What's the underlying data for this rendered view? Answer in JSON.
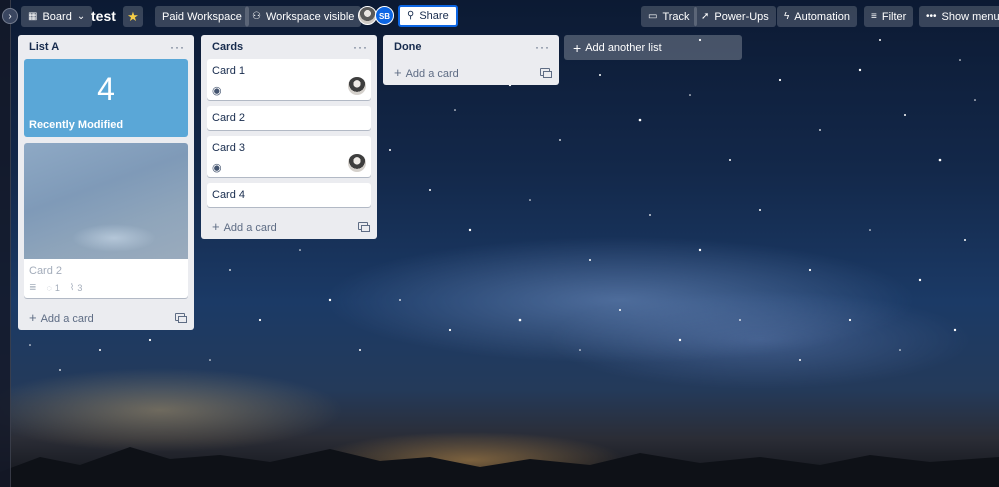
{
  "header": {
    "board_switcher_label": "Board",
    "board_title": "test",
    "workspace_label": "Paid Workspace",
    "visibility_label": "Workspace visible",
    "member_initials": "SB",
    "share_label": "Share",
    "track_label": "Track",
    "powerups_label": "Power-Ups",
    "automation_label": "Automation",
    "filter_label": "Filter",
    "menu_label": "Show menu"
  },
  "lists": [
    {
      "title": "List A",
      "counter_value": "4",
      "counter_label": "Recently Modified",
      "cover_card": {
        "title": "Card 2",
        "comments": "1",
        "attachments": "3"
      },
      "add_card_label": "Add a card"
    },
    {
      "title": "Cards",
      "cards": [
        {
          "title": "Card 1"
        },
        {
          "title": "Card 2"
        },
        {
          "title": "Card 3"
        },
        {
          "title": "Card 4"
        }
      ],
      "add_card_label": "Add a card"
    },
    {
      "title": "Done",
      "add_card_label": "Add a card"
    }
  ],
  "add_list_label": "Add another list",
  "colors": {
    "accent": "#0c66e4",
    "list_bg": "#ebecf0",
    "counter_card": "#5aa7d7"
  },
  "icons": [
    "board-icon",
    "chevron-down-icon",
    "star-icon",
    "people-icon",
    "share-icon",
    "track-icon",
    "powerups-icon",
    "automation-icon",
    "filter-icon",
    "more-icon",
    "eye-icon",
    "description-icon",
    "comment-icon",
    "attachment-icon",
    "template-icon",
    "plus-icon"
  ]
}
